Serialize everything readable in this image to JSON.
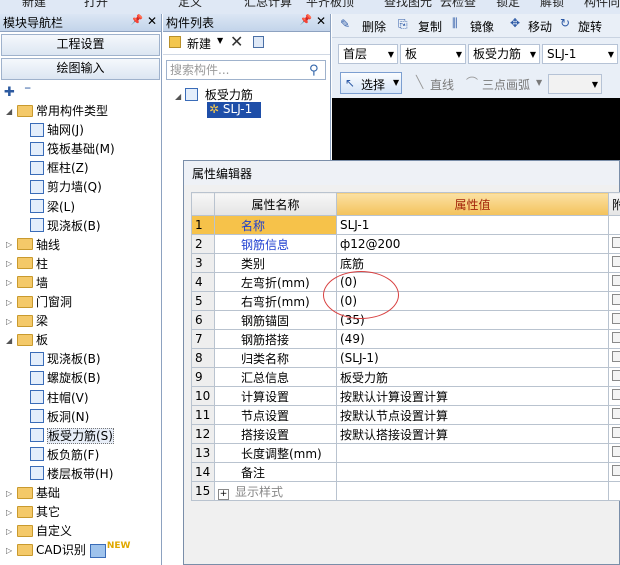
{
  "top_strip": [
    "新建",
    "打开",
    "定义",
    "汇总计算",
    "平齐板顶",
    "查找图元",
    "云检查",
    "锁定",
    "解锁",
    "构件同"
  ],
  "nav": {
    "title": "模块导航栏",
    "btn_engineering": "工程设置",
    "btn_drawing": "绘图输入",
    "tree": [
      {
        "label": "常用构件类型",
        "level": 0,
        "type": "folder",
        "expanded": true
      },
      {
        "label": "轴网(J)",
        "level": 1,
        "type": "item"
      },
      {
        "label": "筏板基础(M)",
        "level": 1,
        "type": "item"
      },
      {
        "label": "框柱(Z)",
        "level": 1,
        "type": "item"
      },
      {
        "label": "剪力墙(Q)",
        "level": 1,
        "type": "item"
      },
      {
        "label": "梁(L)",
        "level": 1,
        "type": "item"
      },
      {
        "label": "现浇板(B)",
        "level": 1,
        "type": "item"
      },
      {
        "label": "轴线",
        "level": 0,
        "type": "folder",
        "expanded": false
      },
      {
        "label": "柱",
        "level": 0,
        "type": "folder",
        "expanded": false
      },
      {
        "label": "墙",
        "level": 0,
        "type": "folder",
        "expanded": false
      },
      {
        "label": "门窗洞",
        "level": 0,
        "type": "folder",
        "expanded": false
      },
      {
        "label": "梁",
        "level": 0,
        "type": "folder",
        "expanded": false
      },
      {
        "label": "板",
        "level": 0,
        "type": "folder",
        "expanded": true
      },
      {
        "label": "现浇板(B)",
        "level": 1,
        "type": "item"
      },
      {
        "label": "螺旋板(B)",
        "level": 1,
        "type": "item"
      },
      {
        "label": "柱帽(V)",
        "level": 1,
        "type": "item"
      },
      {
        "label": "板洞(N)",
        "level": 1,
        "type": "item"
      },
      {
        "label": "板受力筋(S)",
        "level": 1,
        "type": "item",
        "selected": true
      },
      {
        "label": "板负筋(F)",
        "level": 1,
        "type": "item"
      },
      {
        "label": "楼层板带(H)",
        "level": 1,
        "type": "item"
      },
      {
        "label": "基础",
        "level": 0,
        "type": "folder",
        "expanded": false
      },
      {
        "label": "其它",
        "level": 0,
        "type": "folder",
        "expanded": false
      },
      {
        "label": "自定义",
        "level": 0,
        "type": "folder",
        "expanded": false
      },
      {
        "label": "CAD识别",
        "level": 0,
        "type": "folder",
        "expanded": false,
        "badge": "NEW"
      }
    ]
  },
  "components": {
    "title": "构件列表",
    "new_label": "新建",
    "search_placeholder": "搜索构件...",
    "group": "板受力筋",
    "item": "SLJ-1"
  },
  "toolbar": {
    "delete": "删除",
    "copy": "复制",
    "mirror": "镜像",
    "move": "移动",
    "rotate": "旋转",
    "floor": "首层",
    "category": "板",
    "type": "板受力筋",
    "element": "SLJ-1",
    "select": "选择",
    "line": "直线",
    "arc": "三点画弧"
  },
  "props": {
    "title": "属性编辑器",
    "col_name": "属性名称",
    "col_value": "属性值",
    "col_extra": "附",
    "rows": [
      {
        "n": "1",
        "name": "名称",
        "value": "SLJ-1",
        "blue": true
      },
      {
        "n": "2",
        "name": "钢筋信息",
        "value": "ф12@200",
        "blue": true
      },
      {
        "n": "3",
        "name": "类别",
        "value": "底筋",
        "blue": false
      },
      {
        "n": "4",
        "name": "左弯折(mm)",
        "value": "(0)",
        "blue": false
      },
      {
        "n": "5",
        "name": "右弯折(mm)",
        "value": "(0)",
        "blue": false
      },
      {
        "n": "6",
        "name": "钢筋锚固",
        "value": "(35)",
        "blue": false
      },
      {
        "n": "7",
        "name": "钢筋搭接",
        "value": "(49)",
        "blue": false
      },
      {
        "n": "8",
        "name": "归类名称",
        "value": "(SLJ-1)",
        "blue": false
      },
      {
        "n": "9",
        "name": "汇总信息",
        "value": "板受力筋",
        "blue": false
      },
      {
        "n": "10",
        "name": "计算设置",
        "value": "按默认计算设置计算",
        "blue": false
      },
      {
        "n": "11",
        "name": "节点设置",
        "value": "按默认节点设置计算",
        "blue": false
      },
      {
        "n": "12",
        "name": "搭接设置",
        "value": "按默认搭接设置计算",
        "blue": false
      },
      {
        "n": "13",
        "name": "长度调整(mm)",
        "value": "",
        "blue": false
      },
      {
        "n": "14",
        "name": "备注",
        "value": "",
        "blue": false
      },
      {
        "n": "15",
        "name": "显示样式",
        "value": "",
        "blue": false,
        "expand": true
      }
    ]
  },
  "colors": {
    "selected_row": "#f6c24a",
    "link_blue": "#1e3fd0",
    "annotation_red": "#d84040"
  }
}
